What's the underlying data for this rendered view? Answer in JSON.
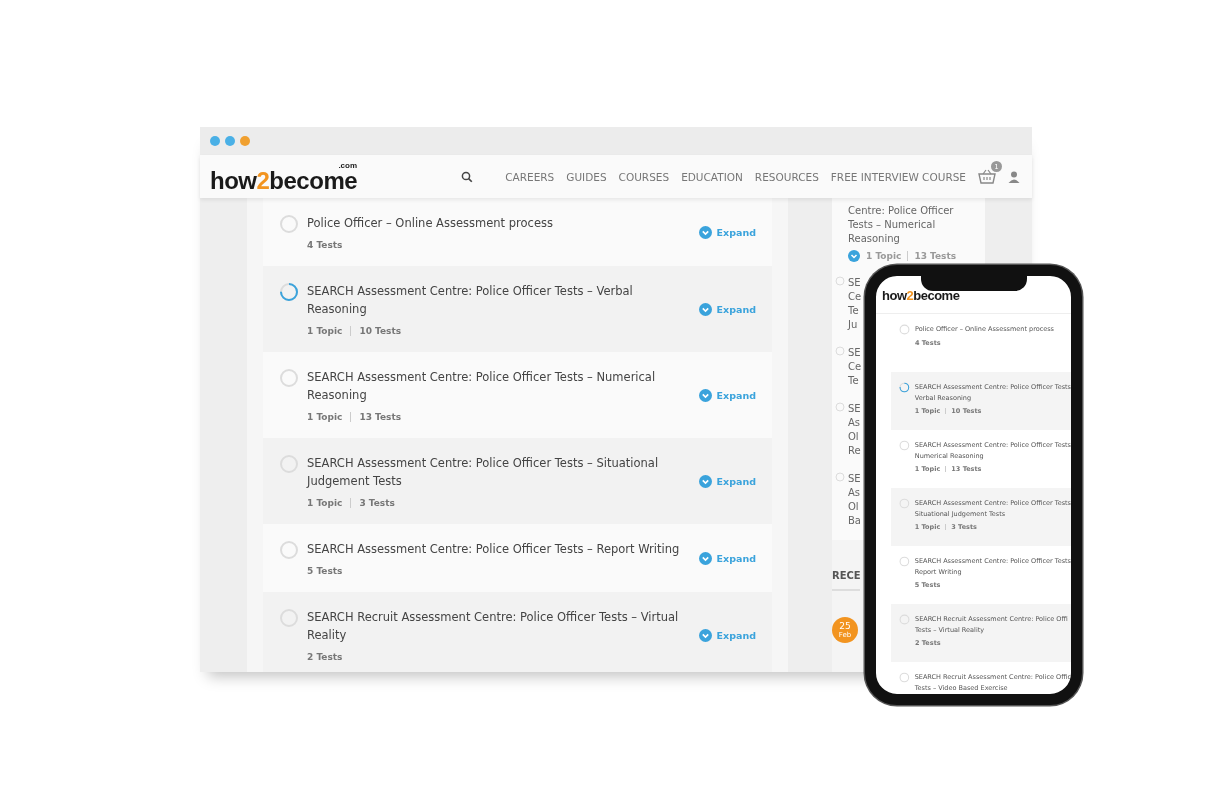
{
  "logo": {
    "before": "how",
    "accent": "2",
    "after": "become",
    "suffix": ".com"
  },
  "nav": {
    "items": [
      "CAREERS",
      "GUIDES",
      "COURSES",
      "EDUCATION",
      "RESOURCES",
      "FREE INTERVIEW COURSE"
    ],
    "cart_count": "1"
  },
  "courses": [
    {
      "title": "Police Officer – Online Assessment process",
      "tests": "4 Tests",
      "in_progress": false,
      "action": "Expand"
    },
    {
      "title": "SEARCH Assessment Centre: Police Officer Tests – Verbal Reasoning",
      "topics": "1 Topic",
      "tests": "10 Tests",
      "in_progress": true,
      "action": "Expand"
    },
    {
      "title": "SEARCH Assessment Centre: Police Officer Tests – Numerical Reasoning",
      "topics": "1 Topic",
      "tests": "13 Tests",
      "in_progress": false,
      "action": "Expand"
    },
    {
      "title": "SEARCH Assessment Centre: Police Officer Tests – Situational Judgement Tests",
      "topics": "1 Topic",
      "tests": "3 Tests",
      "in_progress": false,
      "action": "Expand"
    },
    {
      "title": "SEARCH Assessment Centre: Police Officer Tests – Report Writing",
      "tests": "5 Tests",
      "in_progress": false,
      "action": "Expand"
    },
    {
      "title": "SEARCH Recruit Assessment Centre: Police Officer Tests – Virtual Reality",
      "tests": "2 Tests",
      "in_progress": false,
      "action": "Expand"
    }
  ],
  "sidebar": {
    "items": [
      {
        "lines": [
          "Centre: Police Officer",
          "Tests – Numerical",
          "Reasoning"
        ],
        "topics": "1 Topic",
        "tests": "13 Tests"
      },
      {
        "lines": [
          "SE",
          "Ce",
          "Te",
          "Ju"
        ]
      },
      {
        "lines": [
          "SE",
          "Ce",
          "Te"
        ]
      },
      {
        "lines": [
          "SE",
          "As",
          "Ol",
          "Re"
        ]
      },
      {
        "lines": [
          "SE",
          "As",
          "Ol",
          "Ba"
        ]
      }
    ],
    "heading": "RECE",
    "date": {
      "day": "25",
      "month": "Feb"
    }
  },
  "phone": {
    "logo": {
      "before": "how",
      "accent": "2",
      "after": "become"
    },
    "items": [
      {
        "lines": [
          "Police Officer – Online Assessment process"
        ],
        "tests": "4 Tests",
        "in_progress": false
      },
      {
        "lines": [
          "SEARCH Assessment Centre: Police Officer Tests",
          "Verbal Reasoning"
        ],
        "topics": "1 Topic",
        "tests": "10 Tests",
        "in_progress": true
      },
      {
        "lines": [
          "SEARCH Assessment Centre: Police Officer Tests",
          "Numerical Reasoning"
        ],
        "topics": "1 Topic",
        "tests": "13 Tests",
        "in_progress": false
      },
      {
        "lines": [
          "SEARCH Assessment Centre: Police Officer Tests",
          "Situational Judgement Tests"
        ],
        "topics": "1 Topic",
        "tests": "3 Tests",
        "in_progress": false
      },
      {
        "lines": [
          "SEARCH Assessment Centre: Police Officer Tests",
          "Report Writing"
        ],
        "tests": "5 Tests",
        "in_progress": false
      },
      {
        "lines": [
          "SEARCH Recruit Assessment Centre: Police Offi",
          "Tests – Virtual Reality"
        ],
        "tests": "2 Tests",
        "in_progress": false
      },
      {
        "lines": [
          "SEARCH Recruit Assessment Centre: Police Offic",
          "Tests – Video Based Exercise"
        ],
        "in_progress": false
      }
    ]
  }
}
